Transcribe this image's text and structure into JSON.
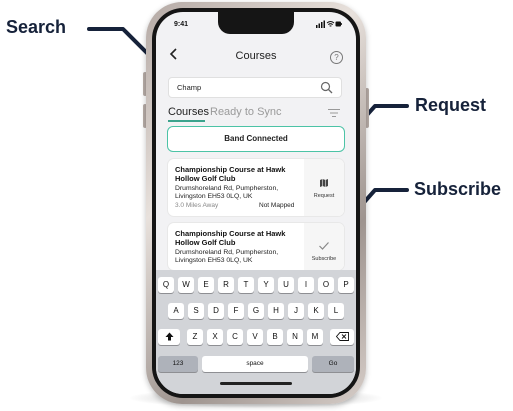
{
  "callouts": {
    "search": "Search",
    "request": "Request",
    "subscribe": "Subscribe"
  },
  "status_bar": {
    "time": "9:41"
  },
  "nav": {
    "title": "Courses",
    "back_icon": "chevron-left-icon",
    "help_icon": "help-circle-icon",
    "help_glyph": "?"
  },
  "search": {
    "value": "Champ",
    "icon": "search-icon"
  },
  "tabs": [
    {
      "label": "Courses",
      "active": true
    },
    {
      "label": "Ready to Sync",
      "active": false
    }
  ],
  "filter_icon": "filter-icon",
  "band_status": "Band Connected",
  "courses": [
    {
      "title": "Championship Course at Hawk Hollow Golf Club",
      "address": "Drumshoreland Rd, Pumpherston, Livingston EH53 0LQ, UK",
      "distance": "3.0 Miles Away",
      "status": "Not Mapped",
      "action_label": "Request",
      "action_icon": "map-icon"
    },
    {
      "title": "Championship Course at Hawk Hollow Golf Club",
      "address": "Drumshoreland Rd, Pumpherston, Livingston EH53 0LQ, UK",
      "action_label": "Subscribe",
      "action_icon": "checkmark-icon"
    }
  ],
  "keyboard": {
    "row1": [
      "Q",
      "W",
      "E",
      "R",
      "T",
      "Y",
      "U",
      "I",
      "O",
      "P"
    ],
    "row2": [
      "A",
      "S",
      "D",
      "F",
      "G",
      "H",
      "J",
      "K",
      "L"
    ],
    "row3": [
      "Z",
      "X",
      "C",
      "V",
      "B",
      "N",
      "M"
    ],
    "numbers": "123",
    "space": "space",
    "go": "Go",
    "shift_icon": "shift-icon",
    "delete_icon": "backspace-icon"
  },
  "colors": {
    "accent": "#4cc3a6",
    "callout_text": "#16223a"
  }
}
